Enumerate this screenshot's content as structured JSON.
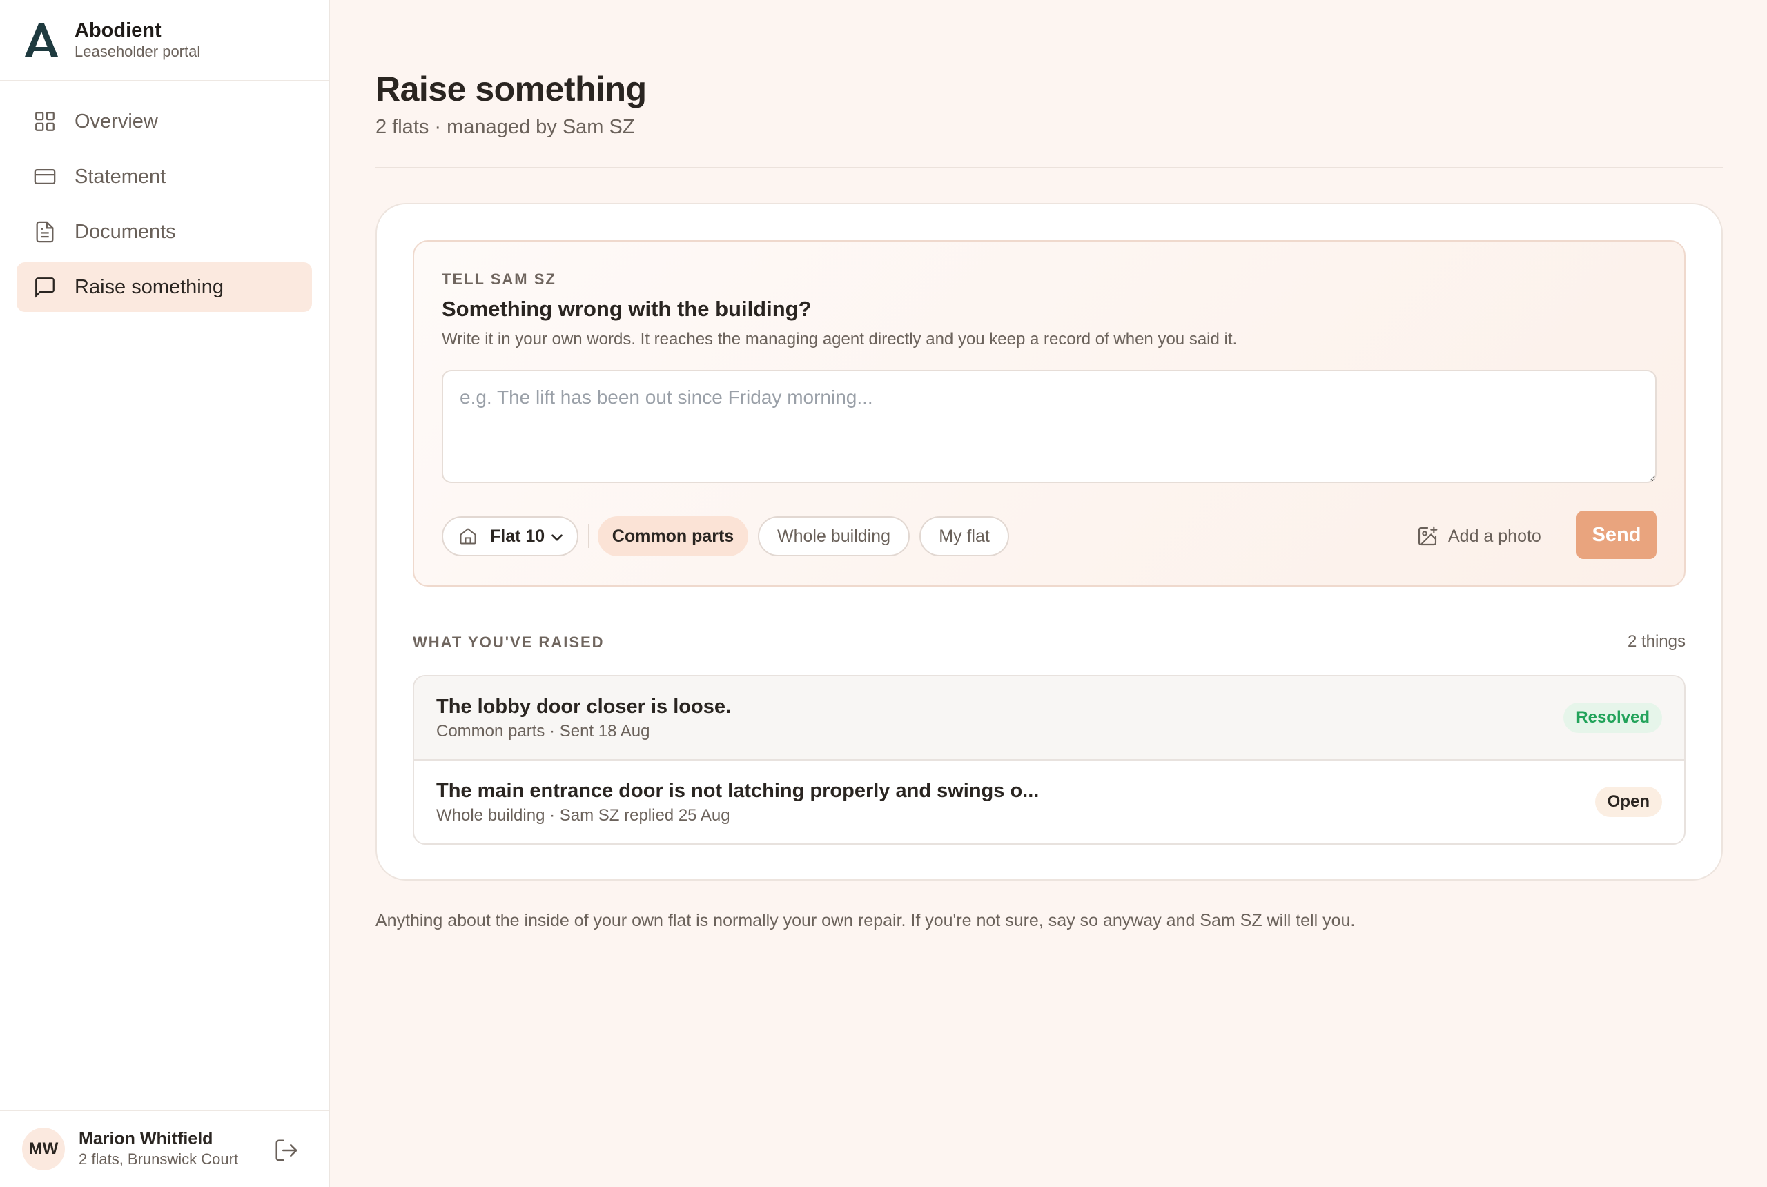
{
  "app": {
    "name": "Abodient",
    "subtitle": "Leaseholder portal"
  },
  "sidebar": {
    "items": [
      {
        "label": "Overview",
        "icon": "grid-icon",
        "active": false
      },
      {
        "label": "Statement",
        "icon": "card-icon",
        "active": false
      },
      {
        "label": "Documents",
        "icon": "document-icon",
        "active": false
      },
      {
        "label": "Raise something",
        "icon": "message-icon",
        "active": true
      }
    ]
  },
  "user": {
    "initials": "MW",
    "name": "Marion Whitfield",
    "detail": "2 flats, Brunswick Court"
  },
  "page": {
    "title": "Raise something",
    "subtitle": "2 flats · managed by Sam SZ"
  },
  "composer": {
    "eyebrow": "TELL SAM SZ",
    "title": "Something wrong with the building?",
    "description": "Write it in your own words. It reaches the managing agent directly and you keep a record of when you said it.",
    "placeholder": "e.g. The lift has been out since Friday morning...",
    "value": "",
    "flat_selected": "Flat 10",
    "categories": [
      {
        "label": "Common parts",
        "selected": true
      },
      {
        "label": "Whole building",
        "selected": false
      },
      {
        "label": "My flat",
        "selected": false
      }
    ],
    "photo_label": "Add a photo",
    "send_label": "Send"
  },
  "raised": {
    "header": "WHAT YOU'VE RAISED",
    "count": "2 things",
    "items": [
      {
        "title": "The lobby door closer is loose.",
        "meta": "Common parts · Sent 18 Aug",
        "status": "Resolved"
      },
      {
        "title": "The main entrance door is not latching properly and swings o...",
        "meta": "Whole building · Sam SZ replied 25 Aug",
        "status": "Open"
      }
    ]
  },
  "footnote": "Anything about the inside of your own flat is normally your own repair. If you're not sure, say so anyway and Sam SZ will tell you.",
  "colors": {
    "accent": "#e9a47e",
    "active_nav_bg": "#fbe9df",
    "resolved": "#22a35a",
    "page_bg": "#fdf5f1"
  }
}
